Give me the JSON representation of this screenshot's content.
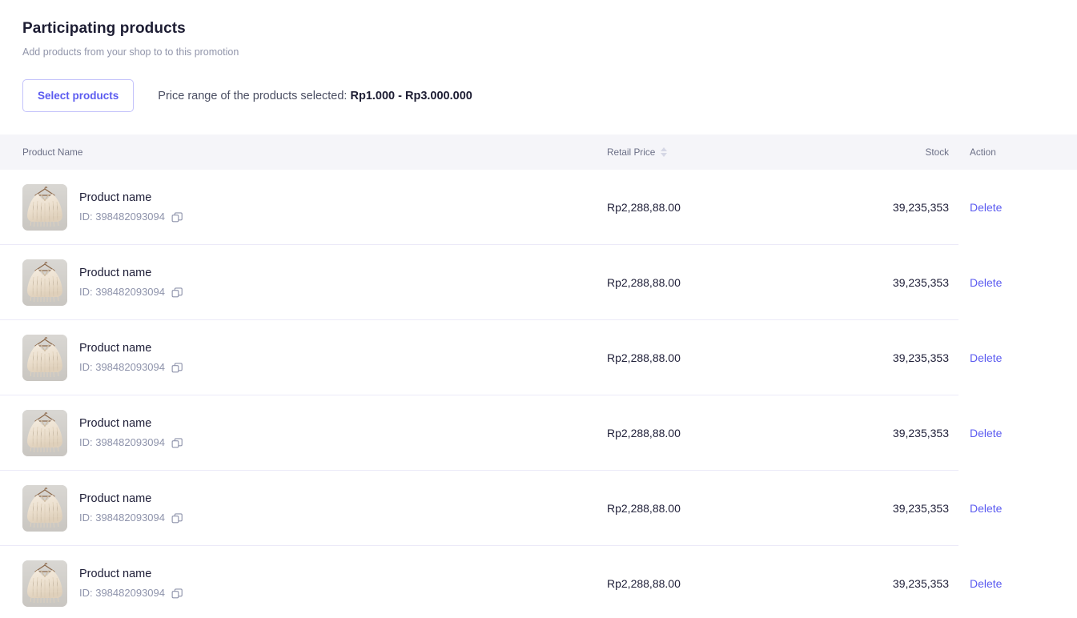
{
  "header": {
    "title": "Participating products",
    "subtitle": "Add products from your shop to to this promotion"
  },
  "toolbar": {
    "select_products_label": "Select products",
    "price_range_label": "Price range of the products selected:",
    "price_range_value": "Rp1.000 - Rp3.000.000"
  },
  "table": {
    "columns": {
      "product_name": "Product Name",
      "retail_price": "Retail Price",
      "stock": "Stock",
      "action": "Action"
    },
    "sort_icon": "sort-ascending-descending-icon",
    "copy_icon": "copy-icon",
    "rows": [
      {
        "name": "Product name",
        "id_label": "ID: 398482093094",
        "price": "Rp2,288,88.00",
        "stock": "39,235,353",
        "action": "Delete"
      },
      {
        "name": "Product name",
        "id_label": "ID: 398482093094",
        "price": "Rp2,288,88.00",
        "stock": "39,235,353",
        "action": "Delete"
      },
      {
        "name": "Product name",
        "id_label": "ID: 398482093094",
        "price": "Rp2,288,88.00",
        "stock": "39,235,353",
        "action": "Delete"
      },
      {
        "name": "Product name",
        "id_label": "ID: 398482093094",
        "price": "Rp2,288,88.00",
        "stock": "39,235,353",
        "action": "Delete"
      },
      {
        "name": "Product name",
        "id_label": "ID: 398482093094",
        "price": "Rp2,288,88.00",
        "stock": "39,235,353",
        "action": "Delete"
      },
      {
        "name": "Product name",
        "id_label": "ID: 398482093094",
        "price": "Rp2,288,88.00",
        "stock": "39,235,353",
        "action": "Delete"
      }
    ]
  },
  "colors": {
    "accent": "#5b5bf0",
    "accent_border": "#c3c2fb",
    "header_band": "#f5f5f9",
    "divider": "#eceaf8",
    "text_dark": "#21213a",
    "text_muted": "#8e93ab"
  }
}
